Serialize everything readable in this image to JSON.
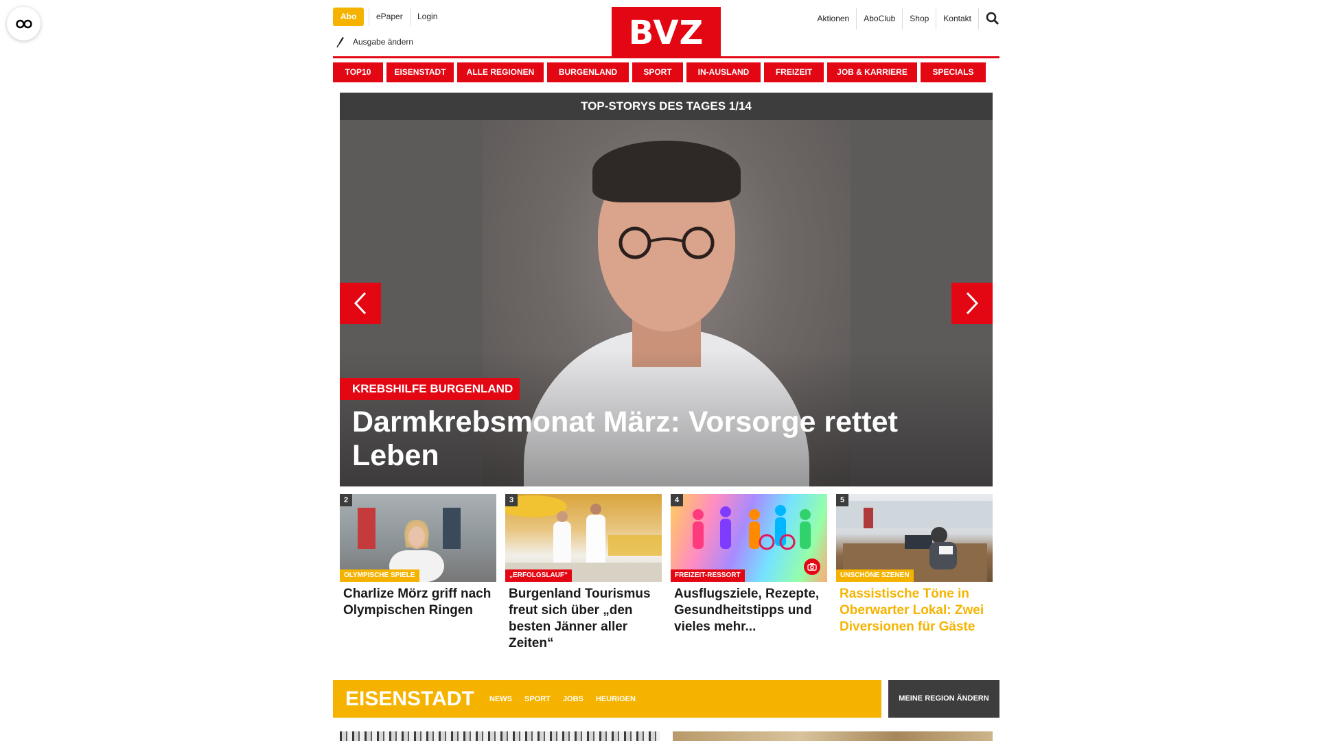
{
  "header": {
    "abo": "Abo",
    "epaper": "ePaper",
    "login": "Login",
    "ausgabe": "Ausgabe ändern",
    "logo": "BVZ",
    "right_links": [
      "Aktionen",
      "AboClub",
      "Shop",
      "Kontakt"
    ]
  },
  "nav": [
    "TOP10",
    "EISENSTADT",
    "ALLE REGIONEN",
    "BURGENLAND",
    "SPORT",
    "IN-AUSLAND",
    "FREIZEIT",
    "JOB & KARRIERE",
    "SPECIALS"
  ],
  "hero": {
    "bar_title": "TOP-STORYS DES TAGES 1/14",
    "tag": "KREBSHILFE BURGENLAND",
    "title": "Darmkrebsmonat März: Vorsorge rettet Leben"
  },
  "teasers": [
    {
      "num": "2",
      "label": "OLYMPISCHE SPIELE",
      "title": "Charlize Mörz griff nach Olympischen Ringen"
    },
    {
      "num": "3",
      "label": "„ERFOLGSLAUF“",
      "title": "Burgenland Tourismus freut sich über „den besten Jänner aller Zeiten“"
    },
    {
      "num": "4",
      "label": "FREIZEIT-RESSORT",
      "title": "Ausflugsziele, Rezepte, Gesundheitstipps und vieles mehr..."
    },
    {
      "num": "5",
      "label": "UNSCHÖNE SZENEN",
      "title": "Rassistische Töne in Oberwarter Lokal: Zwei Diversionen für Gäste"
    }
  ],
  "region": {
    "title": "EISENSTADT",
    "links": [
      "NEWS",
      "SPORT",
      "JOBS",
      "HEURIGEN"
    ],
    "change_button": "MEINE REGION ÄNDERN"
  },
  "colors": {
    "red": "#e30613",
    "yellow": "#f5b300",
    "dark": "#3d3d3d"
  }
}
